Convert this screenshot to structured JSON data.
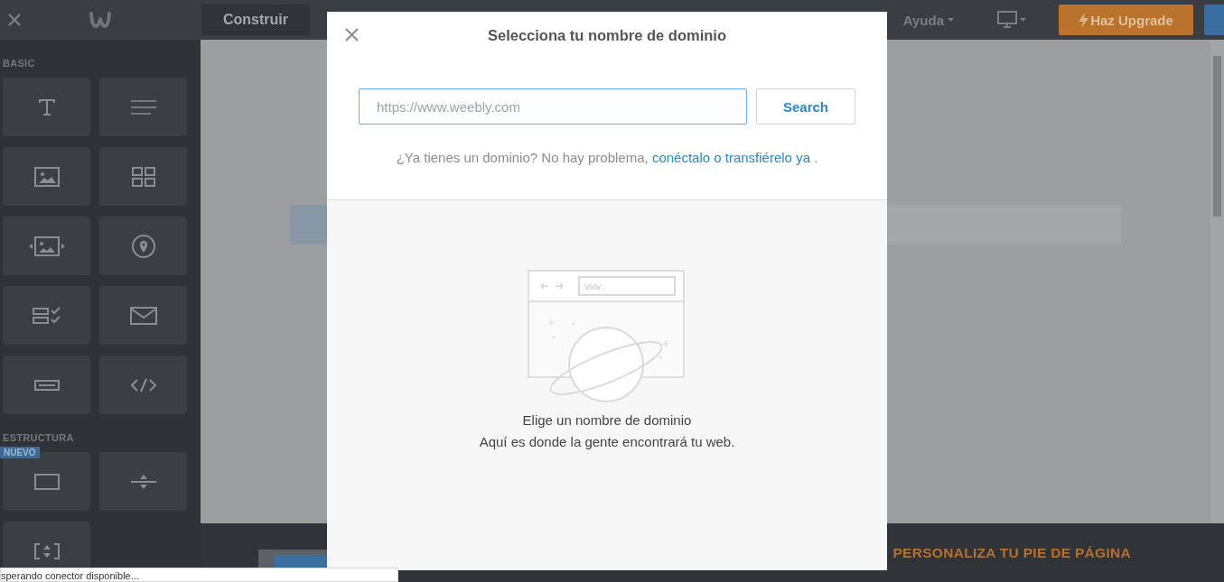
{
  "top_bar": {
    "tabs": [
      {
        "label": "Construir",
        "selected": true
      }
    ],
    "help_menu": "Ayuda",
    "upgrade_button": "Haz Upgrade"
  },
  "sidebar": {
    "sections": [
      {
        "title": "BASIC",
        "items": [
          {
            "kind": "text"
          },
          {
            "kind": "paragraph"
          },
          {
            "kind": "image"
          },
          {
            "kind": "gallery"
          },
          {
            "kind": "slideshow"
          },
          {
            "kind": "map"
          },
          {
            "kind": "form"
          },
          {
            "kind": "contact"
          },
          {
            "kind": "button"
          },
          {
            "kind": "code"
          }
        ]
      },
      {
        "title": "ESTRUCTURA",
        "items": [
          {
            "kind": "section",
            "badge": "NUEVO"
          },
          {
            "kind": "divider"
          },
          {
            "kind": "spacer"
          }
        ]
      }
    ]
  },
  "footer": {
    "title": "PERSONALIZA TU PIE DE PÁGINA"
  },
  "modal": {
    "title": "Selecciona tu nombre de dominio",
    "search": {
      "placeholder": "https://www.weebly.com"
    },
    "search_button": "Search",
    "hint": "¿Ya tienes un dominio? No hay problema,",
    "hint_link": "conéctalo o transfiérelo ya",
    "hint_end": ".",
    "empty_state": {
      "illustration_url": "www.",
      "title": "Elige un nombre de dominio",
      "subtitle": "Aquí es donde la gente encontrará tu web."
    }
  },
  "status_bar": "sperando conector disponible..."
}
